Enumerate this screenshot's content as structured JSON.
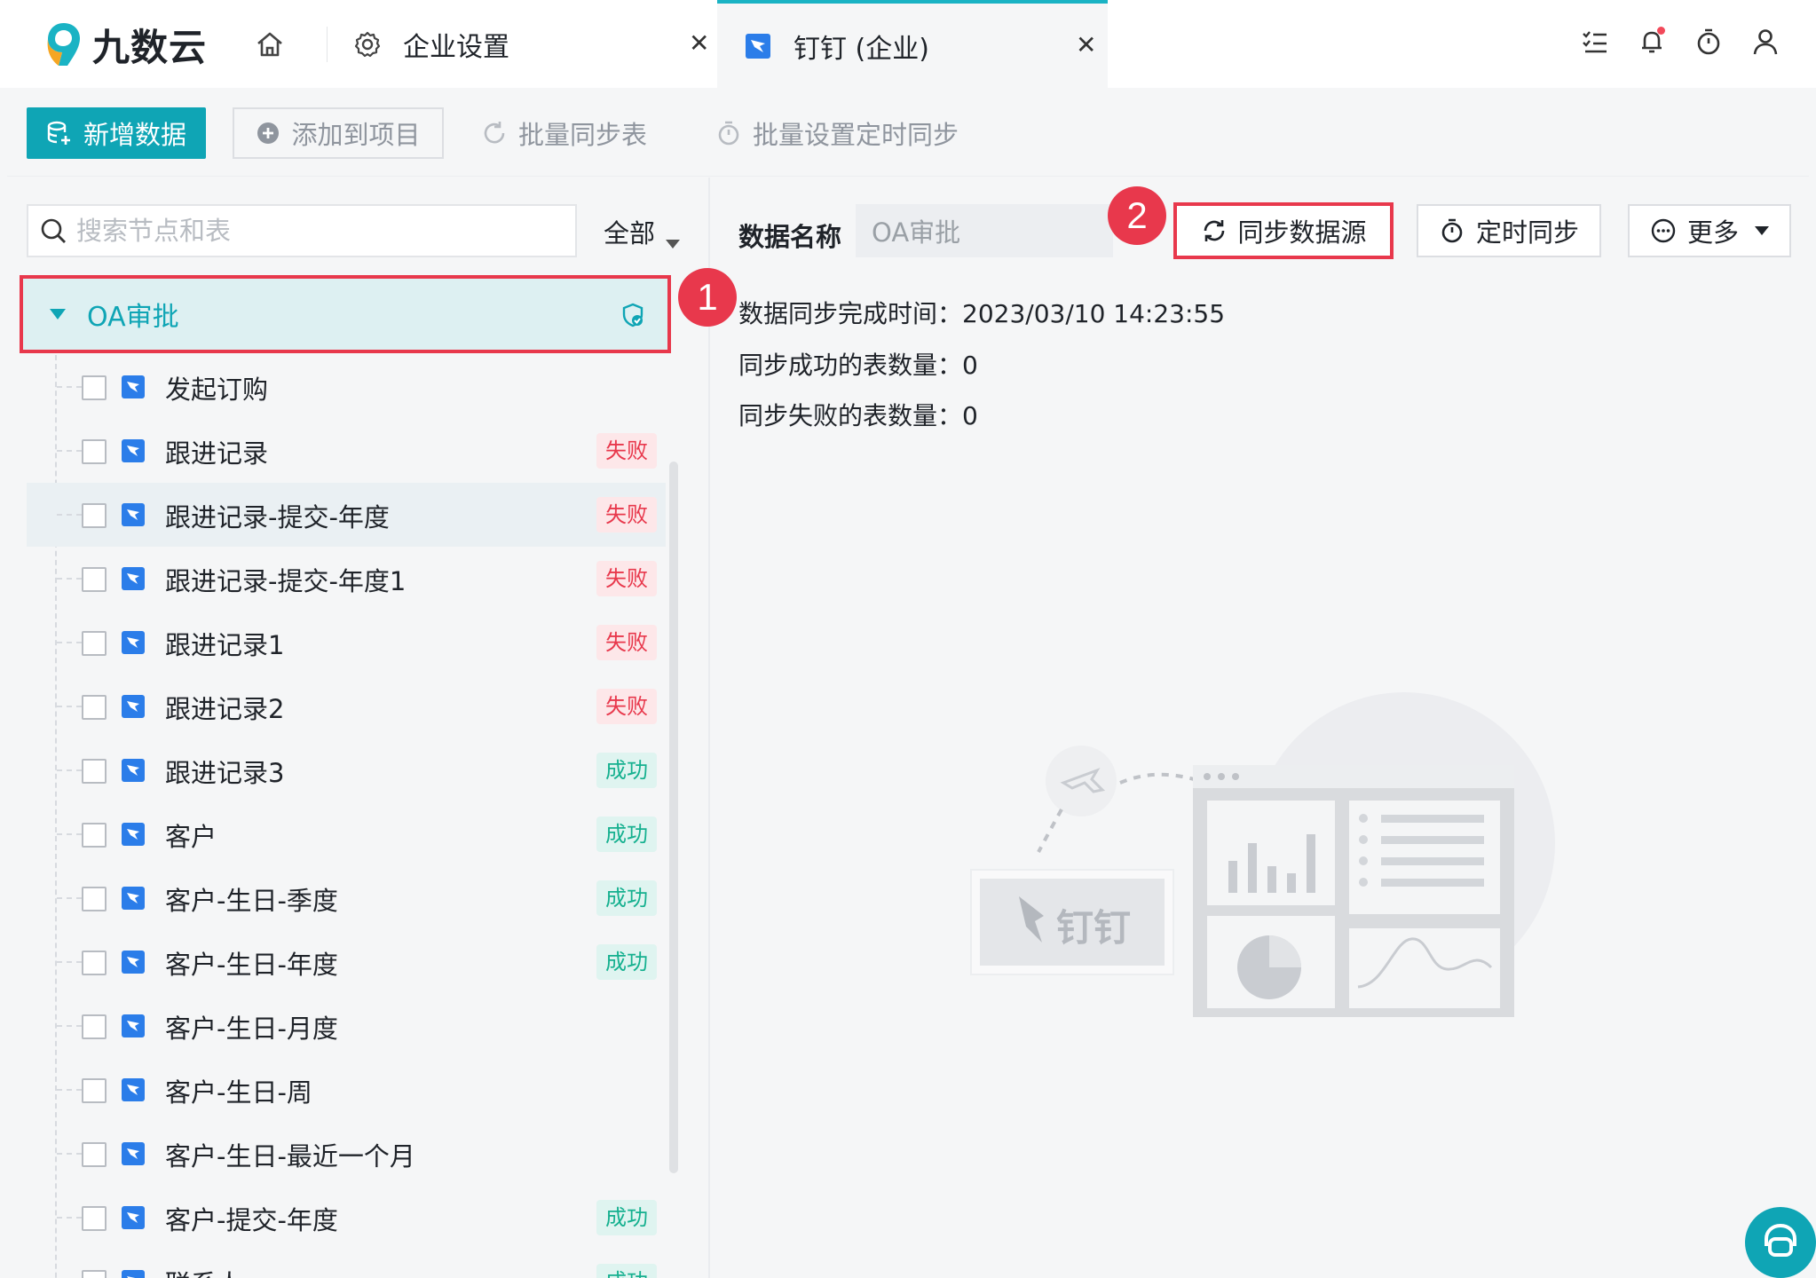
{
  "app": {
    "name": "九数云"
  },
  "tabs": [
    {
      "label": "企业设置"
    },
    {
      "label": "钉钉 (企业)"
    }
  ],
  "toolbar": {
    "add_data": "新增数据",
    "add_to_project": "添加到项目",
    "batch_sync": "批量同步表",
    "batch_timer": "批量设置定时同步"
  },
  "search": {
    "placeholder": "搜索节点和表",
    "filter": "全部"
  },
  "tree": {
    "root": "OA审批",
    "items": [
      {
        "label": "发起订购",
        "status": ""
      },
      {
        "label": "跟进记录",
        "status": "失败"
      },
      {
        "label": "跟进记录-提交-年度",
        "status": "失败"
      },
      {
        "label": "跟进记录-提交-年度1",
        "status": "失败"
      },
      {
        "label": "跟进记录1",
        "status": "失败"
      },
      {
        "label": "跟进记录2",
        "status": "失败"
      },
      {
        "label": "跟进记录3",
        "status": "成功"
      },
      {
        "label": "客户",
        "status": "成功"
      },
      {
        "label": "客户-生日-季度",
        "status": "成功"
      },
      {
        "label": "客户-生日-年度",
        "status": "成功"
      },
      {
        "label": "客户-生日-月度",
        "status": ""
      },
      {
        "label": "客户-生日-周",
        "status": ""
      },
      {
        "label": "客户-生日-最近一个月",
        "status": ""
      },
      {
        "label": "客户-提交-年度",
        "status": "成功"
      },
      {
        "label": "联系人",
        "status": "成功"
      }
    ]
  },
  "detail": {
    "name_label": "数据名称",
    "name_value": "OA审批",
    "sync_source": "同步数据源",
    "schedule": "定时同步",
    "more": "更多",
    "sync_time_label": "数据同步完成时间：",
    "sync_time_value": "2023/03/10 14:23:55",
    "success_label": "同步成功的表数量：",
    "success_value": "0",
    "fail_label": "同步失败的表数量：",
    "fail_value": "0"
  },
  "annotations": {
    "step1": "1",
    "step2": "2"
  },
  "illustration": {
    "brand": "钉钉"
  },
  "colors": {
    "accent": "#0fa5b5",
    "highlight": "#e8384c",
    "fail": "#e8384c",
    "success": "#15b08f"
  }
}
